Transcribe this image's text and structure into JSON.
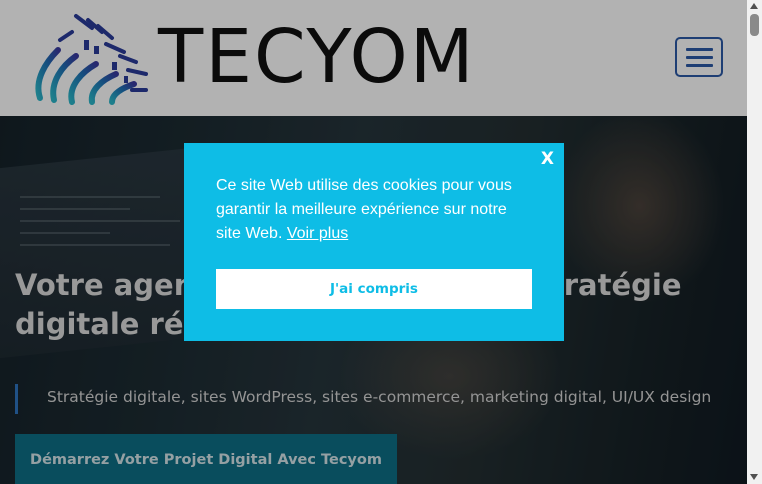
{
  "header": {
    "logo_text": "TECYOM",
    "logo_icon": "tecyom-logo-icon",
    "menu_icon": "hamburger-menu-icon"
  },
  "hero": {
    "title": "Votre agence digitale pour une stratégie digitale réussie",
    "tagline": "Stratégie digitale, sites WordPress, sites e-commerce, marketing digital, UI/UX design",
    "cta_label": "Démarrez Votre Projet Digital Avec Tecyom"
  },
  "cookie": {
    "close_label": "X",
    "message": "Ce site Web utilise des cookies pour vous garantir la meilleure expérience sur notre site Web.",
    "link_label": "Voir plus",
    "accept_label": "J'ai compris"
  },
  "colors": {
    "cookie_bg": "#0ebde6",
    "menu_accent": "#2b5aa6",
    "cta_bg": "#0e6f86",
    "logo_gradient": [
      "#2bb7c9",
      "#1f6fb5",
      "#3a3aa0"
    ]
  }
}
